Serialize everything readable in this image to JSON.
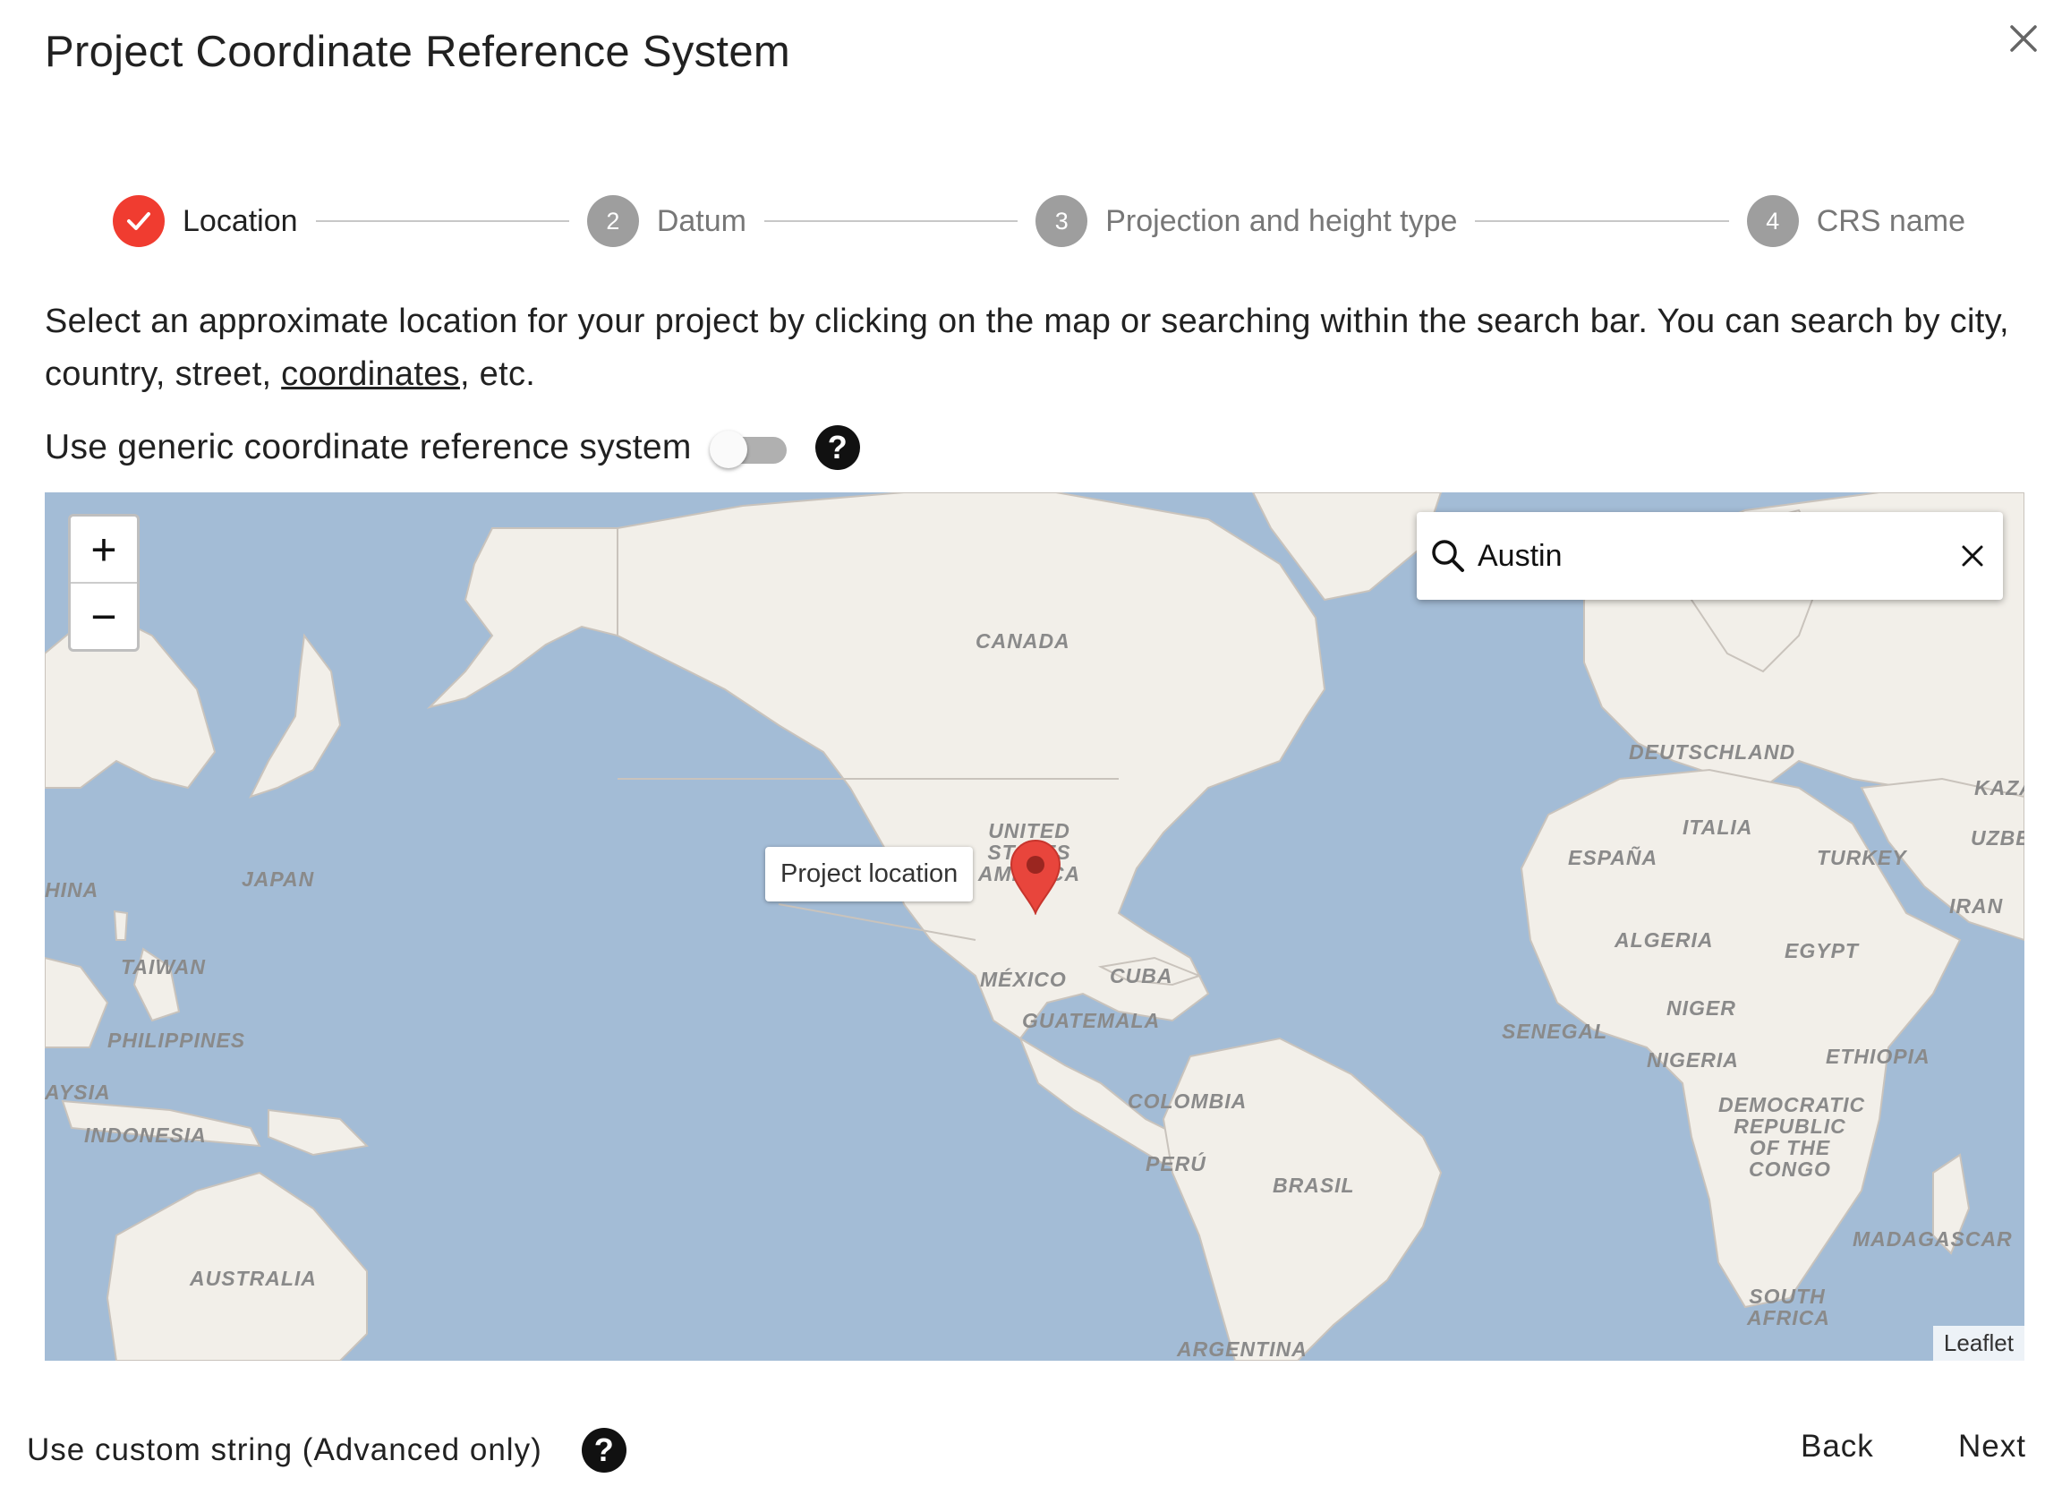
{
  "dialog": {
    "title": "Project Coordinate Reference System"
  },
  "stepper": {
    "steps": [
      {
        "number": "1",
        "label": "Location",
        "state": "completed"
      },
      {
        "number": "2",
        "label": "Datum",
        "state": "pending"
      },
      {
        "number": "3",
        "label": "Projection and height type",
        "state": "pending"
      },
      {
        "number": "4",
        "label": "CRS name",
        "state": "pending"
      }
    ]
  },
  "instructions": {
    "text_before": " Select an approximate location for your project by clicking on the map or searching within the search bar. You can search by city, country, street, ",
    "link": "coordinates",
    "text_after": ", etc."
  },
  "generic_crs": {
    "label": "Use generic coordinate reference system",
    "enabled": false,
    "help_icon": "question-circle-icon"
  },
  "map": {
    "zoom_in": "+",
    "zoom_out": "−",
    "search": {
      "value": "Austin",
      "icon": "search-icon",
      "clear_icon": "close-icon"
    },
    "tooltip": "Project location",
    "marker_icon": "map-pin-icon",
    "attribution": "Leaflet",
    "labels": {
      "canada": "CANADA",
      "usa": "UNITED STATES AMERICA",
      "mexico": "MÉXICO",
      "cuba": "CUBA",
      "guatemala": "GUATEMALA",
      "colombia": "COLOMBIA",
      "peru": "PERÚ",
      "brasil": "BRASIL",
      "argentina": "ARGENTINA",
      "japan": "JAPAN",
      "china": "HINA",
      "taiwan": "TAIWAN",
      "philippines": "PHILIPPINES",
      "malaysia": "AYSIA",
      "indonesia": "INDONESIA",
      "australia": "AUSTRALIA",
      "deutschland": "DEUTSCHLAND",
      "espana": "ESPAÑA",
      "italia": "ITALIA",
      "turkey": "TURKEY",
      "kaza": "KAZA",
      "uzbe": "UZBE",
      "iran": "IRAN",
      "algeria": "ALGERIA",
      "egypt": "EGYPT",
      "niger": "NIGER",
      "senegal": "SENEGAL",
      "nigeria": "NIGERIA",
      "ethiopia": "ETHIOPIA",
      "drc": "DEMOCRATIC REPUBLIC OF THE CONGO",
      "madagascar": "MADAGASCAR",
      "south_africa": "SOUTH AFRICA"
    },
    "colors": {
      "water": "#a3bcd6",
      "land": "#f2efe9",
      "marker": "#e8453c"
    }
  },
  "footer": {
    "custom_string": "Use custom string (Advanced only)",
    "back": "Back",
    "next": "Next"
  }
}
